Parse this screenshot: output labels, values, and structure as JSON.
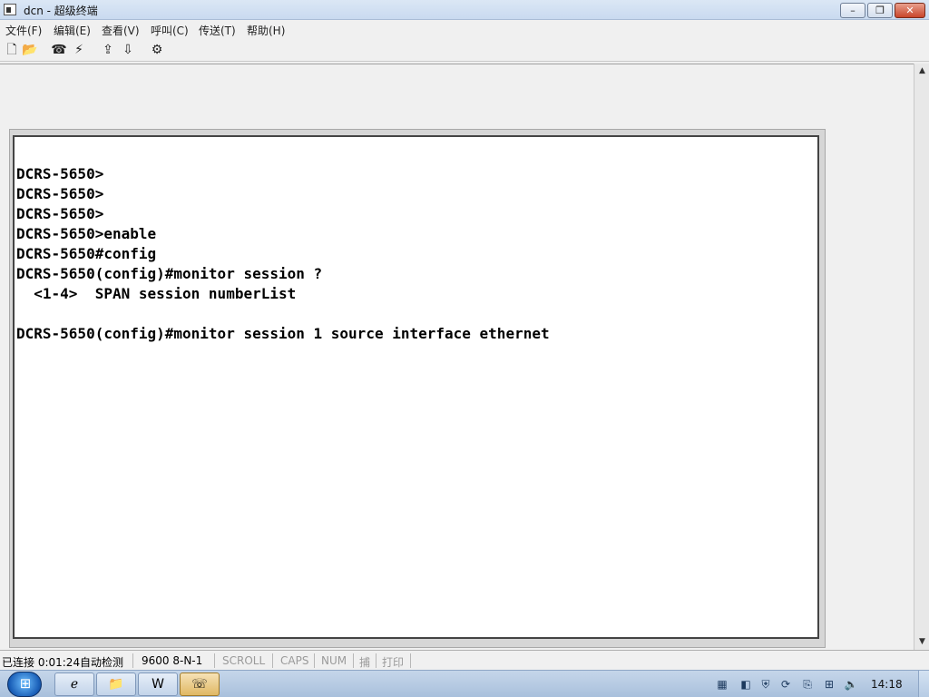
{
  "window": {
    "title": "dcn - 超级终端",
    "minimize_glyph": "–",
    "maximize_glyph": "❐",
    "close_glyph": "✕"
  },
  "menu": [
    "文件(F)",
    "编辑(E)",
    "查看(V)",
    "呼叫(C)",
    "传送(T)",
    "帮助(H)"
  ],
  "toolbar": {
    "icons": [
      "new-icon",
      "open-icon",
      "dial-icon",
      "hangup-icon",
      "send-icon",
      "receive-icon",
      "properties-icon"
    ]
  },
  "terminal": {
    "lines": [
      "DCRS-5650>",
      "DCRS-5650>",
      "DCRS-5650>",
      "DCRS-5650>enable",
      "DCRS-5650#config",
      "DCRS-5650(config)#monitor session ?",
      "  <1-4>  SPAN session numberList",
      "",
      "DCRS-5650(config)#monitor session 1 source interface ethernet"
    ]
  },
  "status": {
    "connection": "已连接 0:01:24",
    "detect": "自动检测",
    "baud": "9600 8-N-1",
    "scroll": "SCROLL",
    "caps": "CAPS",
    "num": "NUM",
    "capture": "捕",
    "print": "打印"
  },
  "taskbar": {
    "apps": [
      "ie-icon",
      "explorer-icon",
      "word-icon",
      "hyperterminal-icon"
    ],
    "tray_icons": [
      "media-icon",
      "network-icon",
      "security-icon",
      "update-icon",
      "usb-icon",
      "network-connection-icon",
      "volume-icon"
    ],
    "clock": "14:18"
  }
}
